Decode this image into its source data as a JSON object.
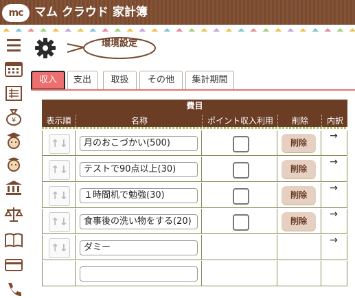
{
  "app": {
    "logo_text": "mc",
    "title": "マム クラウド 家計簿"
  },
  "sidebar": {
    "items": [
      {
        "icon": "menu-icon"
      },
      {
        "icon": "calendar-icon"
      },
      {
        "icon": "ledger-icon"
      },
      {
        "icon": "money-bag-icon"
      },
      {
        "icon": "child-cap-icon"
      },
      {
        "icon": "child-icon"
      },
      {
        "icon": "bank-transfer-icon"
      },
      {
        "icon": "scale-icon"
      },
      {
        "icon": "notebook-icon"
      },
      {
        "icon": "card-icon"
      },
      {
        "icon": "phone-icon"
      }
    ]
  },
  "page": {
    "title": "環境設定",
    "settings_icon": "gear-icon"
  },
  "tabs": [
    {
      "label": "収入",
      "active": true
    },
    {
      "label": "支出",
      "active": false
    },
    {
      "label": "取扱",
      "active": false
    },
    {
      "label": "その他",
      "active": false
    },
    {
      "label": "集計期間",
      "active": false
    }
  ],
  "table": {
    "caption": "費目",
    "columns": [
      "表示順",
      "名称",
      "ポイント収入利用",
      "削除",
      "内訳"
    ],
    "rows": [
      {
        "name": "月のおこづかい(500)",
        "point_checkbox": true,
        "delete_label": "削除",
        "detail_arrow": "→"
      },
      {
        "name": "テストで90点以上(30)",
        "point_checkbox": true,
        "delete_label": "削除",
        "detail_arrow": "→"
      },
      {
        "name": "１時間机で勉強(30)",
        "point_checkbox": true,
        "delete_label": "削除",
        "detail_arrow": "→"
      },
      {
        "name": "食事後の洗い物をする(20)",
        "point_checkbox": true,
        "delete_label": "削除",
        "detail_arrow": "→"
      },
      {
        "name": "ダミー",
        "point_checkbox": false,
        "delete_label": "",
        "detail_arrow": "→"
      },
      {
        "name": "",
        "point_checkbox": false,
        "delete_label": "",
        "detail_arrow": ""
      }
    ],
    "handle_glyph": "↑↓"
  },
  "colors": {
    "header_brown": "#7a4a30",
    "tab_active": "#ec7070",
    "table_header": "#6b3d25",
    "delete_button": "#e6d0c2"
  }
}
